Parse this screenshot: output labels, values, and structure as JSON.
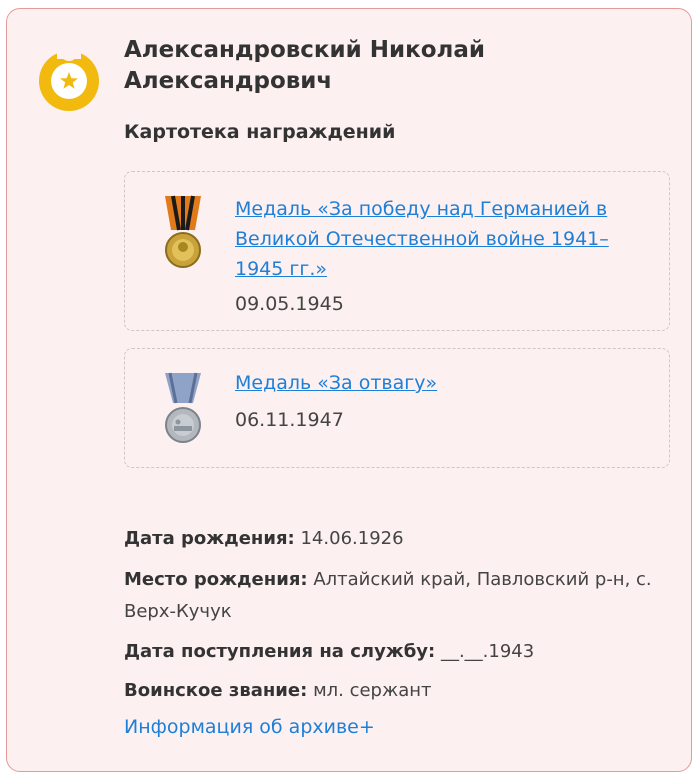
{
  "person": {
    "name": "Александровский Николай Александрович"
  },
  "section_title": "Картотека награждений",
  "awards": [
    {
      "title": "Медаль «За победу над Германией в Великой Отечественной войне 1941–1945 гг.»",
      "date": "09.05.1945",
      "medal_icon": "victory-medal-icon"
    },
    {
      "title": "Медаль «За отвагу»",
      "date": "06.11.1947",
      "medal_icon": "courage-medal-icon"
    }
  ],
  "details": {
    "birth_date_label": "Дата рождения:",
    "birth_date_value": "14.06.1926",
    "birth_place_label": "Место рождения:",
    "birth_place_value": "Алтайский край, Павловский р-н, с. Верх-Кучук",
    "service_date_label": "Дата поступления на службу:",
    "service_date_value": "__.__.1943",
    "rank_label": "Воинское звание:",
    "rank_value": "мл. сержант"
  },
  "archive_link": "Информация об архиве+",
  "colors": {
    "card_background": "#fcf0f0",
    "card_border": "#e59a9a",
    "link": "#1e7fd8",
    "avatar_gold": "#f2b90f"
  }
}
